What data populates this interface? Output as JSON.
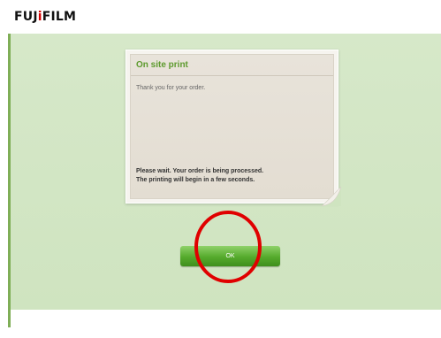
{
  "header": {
    "logo_text": "FUJIFILM"
  },
  "dialog": {
    "title": "On site print",
    "message": "Thank you for your order.",
    "wait_line1": "Please wait. Your order is being processed.",
    "wait_line2": "The printing will begin in a few seconds."
  },
  "actions": {
    "ok_label": "OK"
  },
  "colors": {
    "brand_green": "#5d9a2e",
    "panel_bg": "#d6e8c9",
    "annotation_red": "#e00000"
  }
}
